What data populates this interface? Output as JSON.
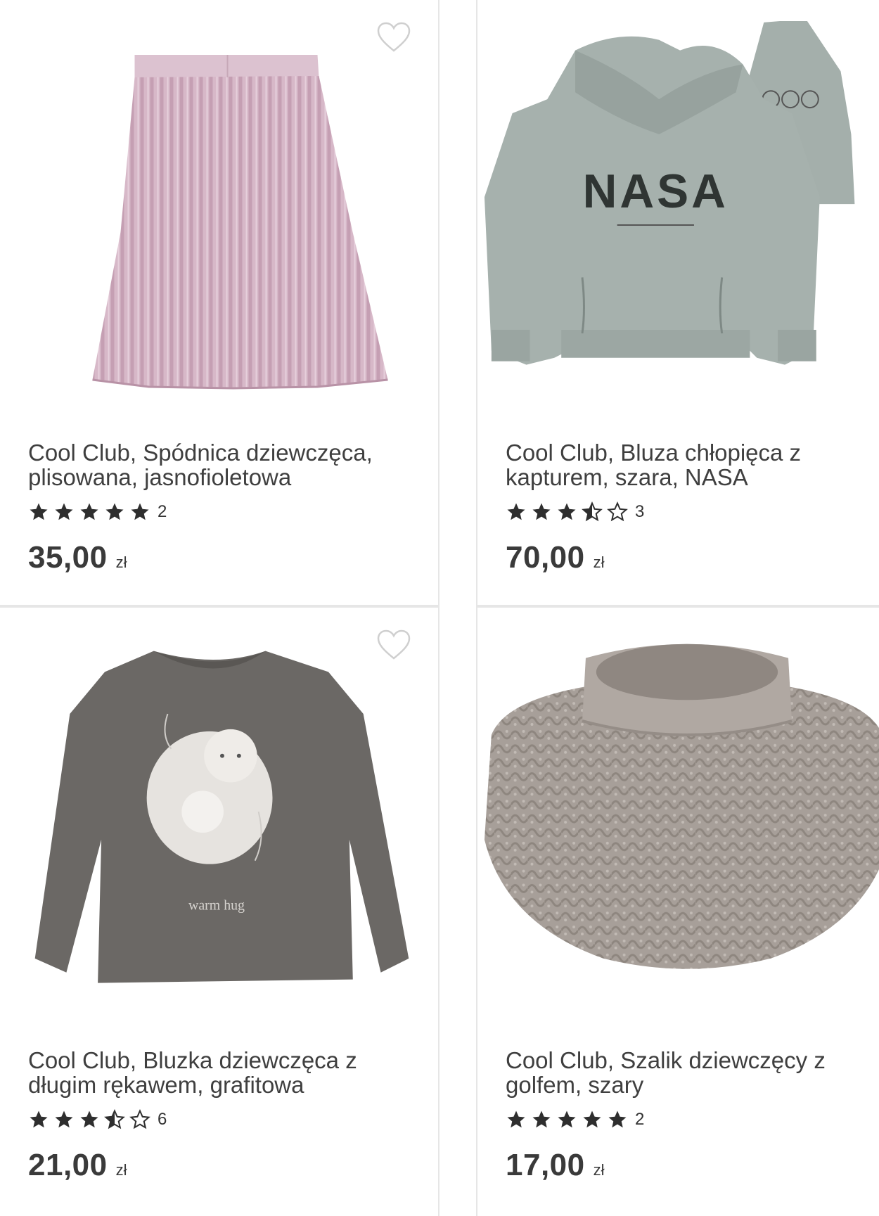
{
  "products": [
    {
      "title": "Cool Club, Spódnica dziewczęca, plisowana, jasnofioletowa",
      "rating": 5,
      "stars": [
        "full",
        "full",
        "full",
        "full",
        "full"
      ],
      "rating_count": "2",
      "price": "35,00",
      "currency": "zł",
      "image": "pink-pleated-skirt"
    },
    {
      "title": "Cool Club, Bluza chłopięca z kapturem, szara, NASA",
      "rating": 3.5,
      "stars": [
        "full",
        "full",
        "full",
        "half",
        "empty"
      ],
      "rating_count": "3",
      "price": "70,00",
      "currency": "zł",
      "image": "grey-nasa-hoodie",
      "print_text": "NASA"
    },
    {
      "title": "Cool Club, Bluzka dziewczęca z długim rękawem, grafitowa",
      "rating": 3.5,
      "stars": [
        "full",
        "full",
        "full",
        "half",
        "empty"
      ],
      "rating_count": "6",
      "price": "21,00",
      "currency": "zł",
      "image": "graphite-bear-longsleeve",
      "print_text": "warm hug"
    },
    {
      "title": "Cool Club, Szalik dziewczęcy z golfem, szary",
      "rating": 5,
      "stars": [
        "full",
        "full",
        "full",
        "full",
        "full"
      ],
      "rating_count": "2",
      "price": "17,00",
      "currency": "zł",
      "image": "grey-knit-neck-warmer"
    }
  ],
  "colors": {
    "star": "#2e2e2e",
    "border": "#e6e6e6",
    "heart_outline": "#cfcfcf"
  },
  "icons": {
    "favorite": "heart-outline-icon",
    "rating": "star-icon"
  }
}
